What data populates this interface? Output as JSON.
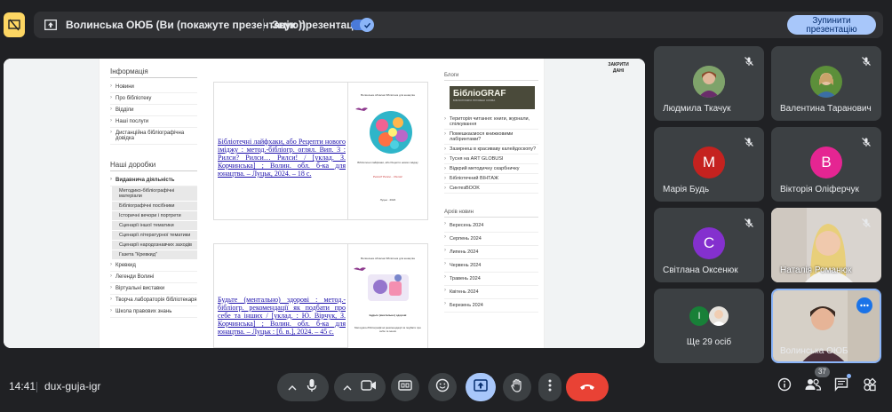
{
  "top_bar": {
    "presentation_title": "Волинська ОЮБ (Ви (покажуте презентацію))",
    "sound_label": "Звук презентації",
    "stop_button_label": "Зупинити презентацію"
  },
  "shared_page": {
    "left_sidebar": {
      "section1_title": "Інформація",
      "section1_items": [
        "Новини",
        "Про бібліотеку",
        "Відділи",
        "Наші послуги",
        "Дистанційна бібліографічна довідка"
      ],
      "section2_title": "Наші доробки",
      "section2_active": "Видавнича діяльність",
      "section2_sub": [
        "Методико-бібліографічні матеріали",
        "Бібліографічні посібники",
        "Історичні вечори і портрети",
        "Сценарії іншої тематики",
        "Сценарії літературної тематики",
        "Сценарії народознавчих заходів",
        "Газета \"Кревкид\""
      ],
      "section2_items": [
        "Кревкид",
        "Легенди Волині",
        "Віртуальні виставки",
        "Творча лабораторія бібліотекаря",
        "Школа правових знань"
      ]
    },
    "doc1_link": "Бібліотечні лайфхаки, або Рецепти нового іміджу : метод.-бібліогр. оглял. Вип. 3 : Рилси? Рилси… Рилси! / [уклад. З. Корчинська] ; Волин. обл. б-ка для юнацтва. – Луцьк, 2024. – 18 с.",
    "doc1_thumb_top": "Волинська обласна бібліотека для юнацтва",
    "doc1_thumb_mid": "Бібліотечні лайфхаки, або Рецепти нового іміджу",
    "doc1_thumb_sub": "Рилси? Рилси… Рилси!",
    "doc1_thumb_city": "Луцьк · 2024",
    "doc2_link": "Будьте (ментально) здорові : метод.-бібліогр. рекомендації як подбати про себе та інших / [уклад. : Ю. Вірчук, З. Корчинська] ; Волин. обл. б-ка для юнацтва. – Луцьк : [б. в.], 2024. – 45 с.",
    "doc2_thumb_top": "Волинська обласна бібліотека для юнацтва",
    "doc2_thumb_mid": "Будьте (ментально) здорові",
    "doc2_thumb_sub": "Методико-бібліографічні рекомендації як подбати про себе та інших",
    "right_sidebar": {
      "close_today": "ЗАКРИТИ ДАНІ",
      "blogs_title": "Блоги",
      "bibliograf_logo": "БібліоGRAF",
      "bibliograf_sub": "БІБЛІОГРАФІЯ: ПРОМЕНІ СЛОВА",
      "blogs": [
        "Територія читання: книги, журнали, спілкування",
        "Помешкаємося книжковими лабіринтами?",
        "Зазирнеш в красиваву калейдоскопу?",
        "Тусня на ART GLOBUSI",
        "Відкрий методичну скарбничку",
        "Бібліотечний ВІНТАЖ",
        "СинтезBOOK"
      ],
      "archive_title": "Архів новин",
      "archive": [
        "Вересень 2024",
        "Серпень 2024",
        "Липень 2024",
        "Червень 2024",
        "Травень 2024",
        "Квітень 2024",
        "Березень 2024"
      ]
    }
  },
  "participants": [
    {
      "name": "Людмила Ткачук",
      "muted": true,
      "type": "photo"
    },
    {
      "name": "Валентина Таранович",
      "muted": true,
      "type": "photo"
    },
    {
      "name": "Марія Будь",
      "muted": true,
      "type": "letter",
      "letter": "М",
      "color": "#c5221f"
    },
    {
      "name": "Вікторія Оліферчук",
      "muted": true,
      "type": "letter",
      "letter": "В",
      "color": "#e52592"
    },
    {
      "name": "Світлана Оксенюк",
      "muted": true,
      "type": "letter",
      "letter": "С",
      "color": "#8430ce"
    },
    {
      "name": "Наталія Романюк",
      "muted": true,
      "type": "video"
    },
    {
      "name": "Ще 29 осіб",
      "type": "group",
      "letter": "І"
    },
    {
      "name": "Волинська ОЮБ",
      "type": "self"
    }
  ],
  "bottom_bar": {
    "time": "14:41",
    "meeting_code": "dux-guja-igr",
    "participant_count": "37"
  },
  "colors": {
    "background": "#202124",
    "tile": "#3c4043",
    "accent": "#8ab4f8",
    "hangup": "#e94235"
  }
}
